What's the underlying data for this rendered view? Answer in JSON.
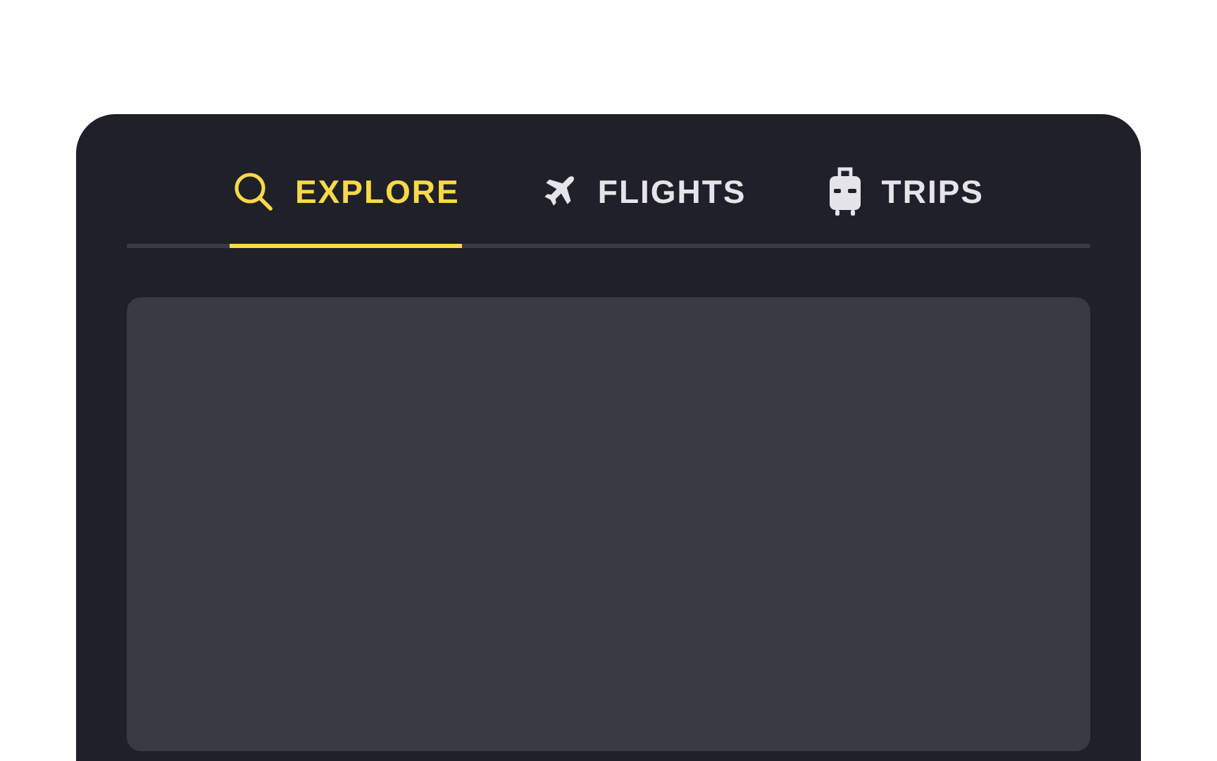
{
  "tabs": [
    {
      "kind": "search",
      "label": "EXPLORE",
      "selected": true
    },
    {
      "kind": "plane",
      "label": "FLIGHTS",
      "selected": false
    },
    {
      "kind": "suitcase",
      "label": "TRIPS",
      "selected": false
    }
  ],
  "content": {
    "kind": "empty-panel"
  }
}
